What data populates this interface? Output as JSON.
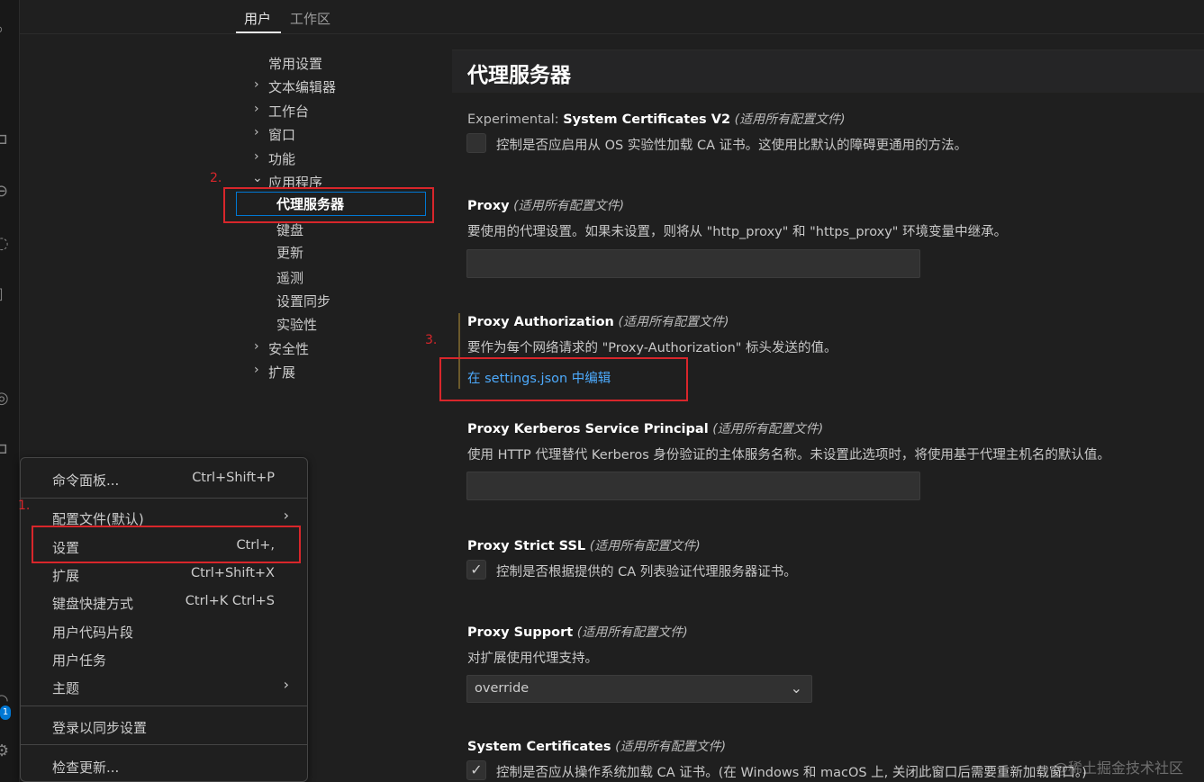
{
  "tabs": {
    "user": "用户",
    "workspace": "工作区"
  },
  "toc": {
    "items": [
      {
        "label": "常用设置",
        "chevron": ""
      },
      {
        "label": "文本编辑器",
        "chevron": "›"
      },
      {
        "label": "工作台",
        "chevron": "›"
      },
      {
        "label": "窗口",
        "chevron": "›"
      },
      {
        "label": "功能",
        "chevron": "›"
      },
      {
        "label": "应用程序",
        "chevron": "⌄"
      },
      {
        "label": "代理服务器"
      },
      {
        "label": "键盘"
      },
      {
        "label": "更新"
      },
      {
        "label": "遥测"
      },
      {
        "label": "设置同步"
      },
      {
        "label": "实验性"
      },
      {
        "label": "安全性",
        "chevron": "›"
      },
      {
        "label": "扩展",
        "chevron": "›"
      }
    ]
  },
  "content": {
    "title": "代理服务器",
    "scope": "(适用所有配置文件)",
    "settings": [
      {
        "category": "Experimental: ",
        "name": "System Certificates V2",
        "desc": "控制是否应启用从 OS 实验性加载 CA 证书。这使用比默认的障碍更通用的方法。",
        "checked": ""
      },
      {
        "category": "",
        "name": "Proxy",
        "desc": "要使用的代理设置。如果未设置，则将从 \"http_proxy\" 和 \"https_proxy\" 环境变量中继承。",
        "value": ""
      },
      {
        "category": "",
        "name": "Proxy Authorization",
        "desc": "要作为每个网络请求的 \"Proxy-Authorization\" 标头发送的值。",
        "link": "在 settings.json 中编辑"
      },
      {
        "category": "",
        "name": "Proxy Kerberos Service Principal",
        "desc": "使用 HTTP 代理替代 Kerberos 身份验证的主体服务名称。未设置此选项时，将使用基于代理主机名的默认值。",
        "value": ""
      },
      {
        "category": "",
        "name": "Proxy Strict SSL",
        "desc": "控制是否根据提供的 CA 列表验证代理服务器证书。",
        "checked": "✓"
      },
      {
        "category": "",
        "name": "Proxy Support",
        "desc": "对扩展使用代理支持。",
        "value": "override"
      },
      {
        "category": "",
        "name": "System Certificates",
        "desc": "控制是否应从操作系统加载 CA 证书。(在 Windows 和 macOS 上, 关闭此窗口后需要重新加载窗口。)",
        "checked": "✓"
      }
    ]
  },
  "menu": {
    "items": [
      {
        "label": "命令面板...",
        "key": "Ctrl+Shift+P"
      },
      {
        "label": "配置文件(默认)",
        "arrow": "›"
      },
      {
        "label": "设置",
        "key": "Ctrl+,"
      },
      {
        "label": "扩展",
        "key": "Ctrl+Shift+X"
      },
      {
        "label": "键盘快捷方式",
        "key": "Ctrl+K Ctrl+S"
      },
      {
        "label": "用户代码片段"
      },
      {
        "label": "用户任务"
      },
      {
        "label": "主题",
        "arrow": "›"
      },
      {
        "label": "登录以同步设置"
      },
      {
        "label": "检查更新..."
      }
    ]
  },
  "annotations": {
    "one": "1.",
    "two": "2.",
    "three": "3."
  },
  "activity": {
    "badge": "1"
  },
  "watermark": "@稀土掘金技术社区",
  "colors": {
    "accent": "#0078d4",
    "annotation": "#d8262b",
    "link": "#4daafc"
  }
}
